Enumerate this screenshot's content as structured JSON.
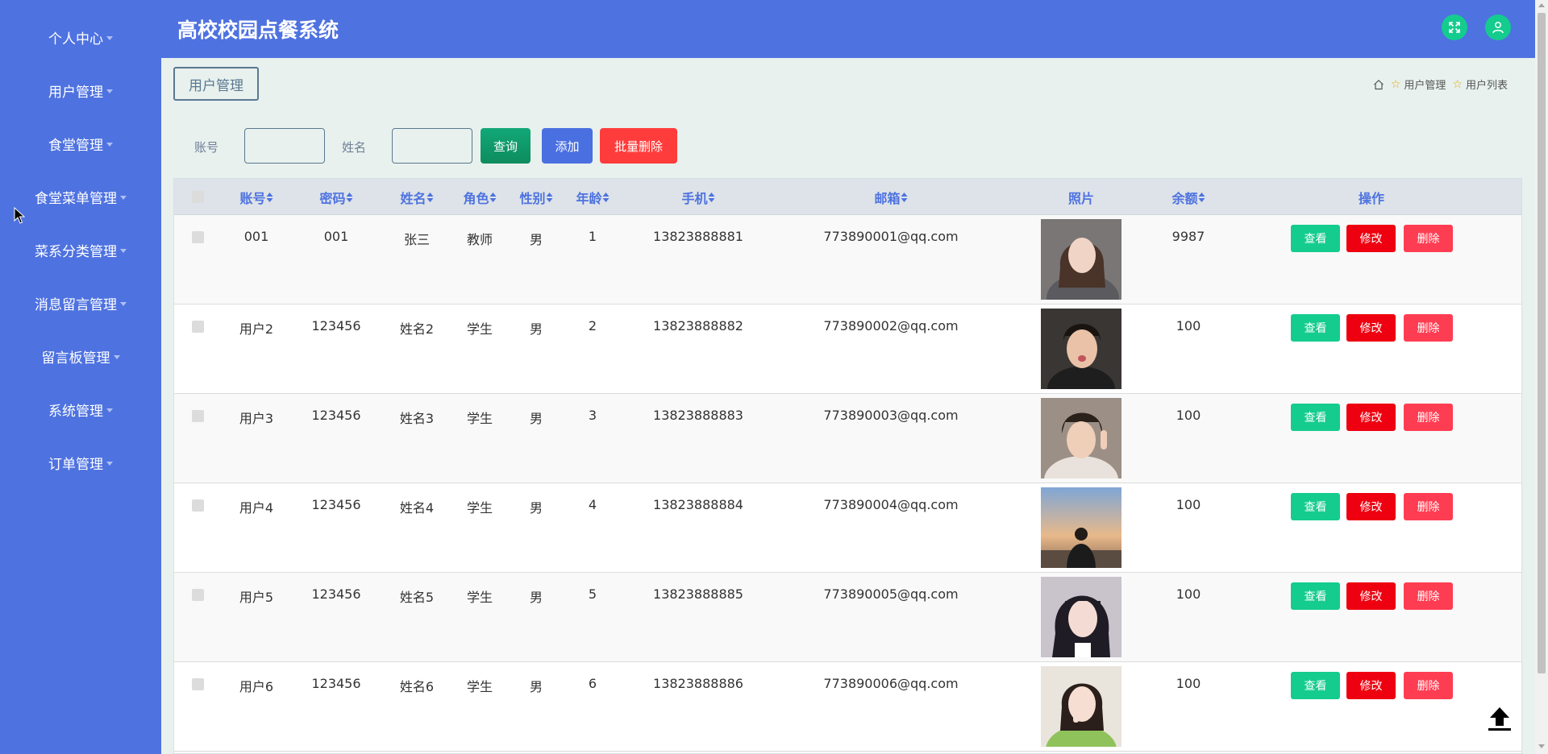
{
  "app": {
    "title": "高校校园点餐系统"
  },
  "sidebar": {
    "items": [
      {
        "label": "个人中心"
      },
      {
        "label": "用户管理"
      },
      {
        "label": "食堂管理"
      },
      {
        "label": "食堂菜单管理"
      },
      {
        "label": "菜系分类管理"
      },
      {
        "label": "消息留言管理"
      },
      {
        "label": "留言板管理"
      },
      {
        "label": "系统管理"
      },
      {
        "label": "订单管理"
      }
    ]
  },
  "header": {
    "expand_icon": "expand-icon",
    "user_icon": "user-icon"
  },
  "tab": {
    "label": "用户管理"
  },
  "breadcrumb": {
    "items": [
      "用户管理",
      "用户列表"
    ]
  },
  "search": {
    "account_label": "账号",
    "account_value": "",
    "name_label": "姓名",
    "name_value": "",
    "search_button": "查询",
    "add_button": "添加",
    "batch_delete_button": "批量删除"
  },
  "table": {
    "columns": [
      "账号",
      "密码",
      "姓名",
      "角色",
      "性别",
      "年龄",
      "手机",
      "邮箱",
      "照片",
      "余额",
      "操作"
    ],
    "actions": {
      "view": "查看",
      "edit": "修改",
      "delete": "删除"
    },
    "rows": [
      {
        "account": "001",
        "password": "001",
        "name": "张三",
        "role": "教师",
        "gender": "男",
        "age": "1",
        "phone": "13823888881",
        "email": "773890001@qq.com",
        "balance": "9987"
      },
      {
        "account": "用户2",
        "password": "123456",
        "name": "姓名2",
        "role": "学生",
        "gender": "男",
        "age": "2",
        "phone": "13823888882",
        "email": "773890002@qq.com",
        "balance": "100"
      },
      {
        "account": "用户3",
        "password": "123456",
        "name": "姓名3",
        "role": "学生",
        "gender": "男",
        "age": "3",
        "phone": "13823888883",
        "email": "773890003@qq.com",
        "balance": "100"
      },
      {
        "account": "用户4",
        "password": "123456",
        "name": "姓名4",
        "role": "学生",
        "gender": "男",
        "age": "4",
        "phone": "13823888884",
        "email": "773890004@qq.com",
        "balance": "100"
      },
      {
        "account": "用户5",
        "password": "123456",
        "name": "姓名5",
        "role": "学生",
        "gender": "男",
        "age": "5",
        "phone": "13823888885",
        "email": "773890005@qq.com",
        "balance": "100"
      },
      {
        "account": "用户6",
        "password": "123456",
        "name": "姓名6",
        "role": "学生",
        "gender": "男",
        "age": "6",
        "phone": "13823888886",
        "email": "773890006@qq.com",
        "balance": "100"
      }
    ]
  },
  "colors": {
    "sidebar": "#4e72e0",
    "accent_green": "#14cc8e",
    "danger": "#ee0010",
    "header_text": "#4e72e0"
  }
}
